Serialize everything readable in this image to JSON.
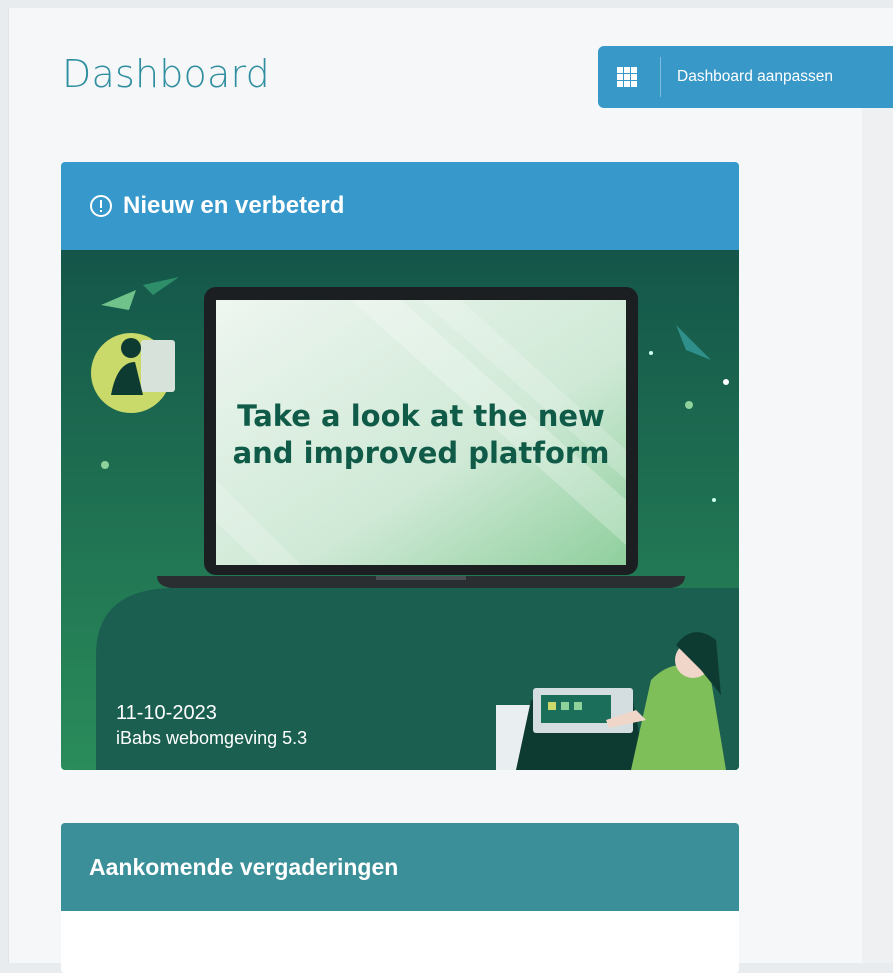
{
  "page": {
    "title": "Dashboard"
  },
  "toolbar": {
    "customize_label": "Dashboard aanpassen",
    "customize_icon": "grid-icon"
  },
  "news_card": {
    "title": "Nieuw en verbeterd",
    "icon": "info-icon",
    "banner": {
      "headline_line1": "Take a look at the new",
      "headline_line2": "and improved platform",
      "date": "11-10-2023",
      "release": "iBabs webomgeving 5.3"
    }
  },
  "meetings_card": {
    "title": "Aankomende vergaderingen"
  },
  "colors": {
    "accent_blue": "#3799cb",
    "teal_header": "#3b8f99",
    "title_teal": "#2f8fa0",
    "banner_green": "#1e6f52",
    "headline_green": "#0f5b48"
  }
}
